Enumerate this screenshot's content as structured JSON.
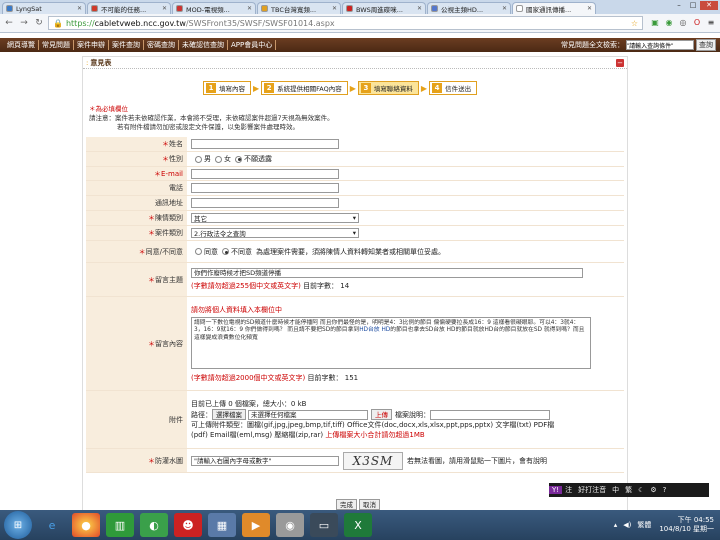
{
  "browser": {
    "tabs": [
      {
        "label": "LyngSat",
        "color": "#3a7ac8",
        "active": false
      },
      {
        "label": "不可能的任務...",
        "color": "#d03a2a",
        "active": false
      },
      {
        "label": "MOD-電視頻...",
        "color": "#cc3333",
        "active": false
      },
      {
        "label": "TBC台灣寬頻...",
        "color": "#e0a020",
        "active": false
      },
      {
        "label": "BWS周進碟咪...",
        "color": "#cc2222",
        "active": false
      },
      {
        "label": "公視主頻HD...",
        "color": "#5577cc",
        "active": false
      },
      {
        "label": "國家通訊傳播...",
        "color": "#ffffff",
        "active": true
      }
    ],
    "url_https": "https://",
    "url_domain": "cabletvweb.ncc.gov.tw",
    "url_path": "/SWSFront35/SWSF/SWSF01014.aspx"
  },
  "sitenav": {
    "links": [
      "網頁導覽",
      "常見問題",
      "案件申辦",
      "案件查詢",
      "密碼查詢",
      "未確認信查詢",
      "APP會員中心"
    ],
    "search_label": "常見問題全文檢索：",
    "search_placeholder": "\"請輸入查詢條件\"",
    "search_button": "查詢"
  },
  "panel": {
    "title": "意見表",
    "steps": [
      {
        "num": "1",
        "label": "填寫內容",
        "active": false
      },
      {
        "num": "2",
        "label": "系統提供相關FAQ內容",
        "active": false
      },
      {
        "num": "3",
        "label": "填寫聯絡資料",
        "active": true
      },
      {
        "num": "4",
        "label": "信件送出",
        "active": false
      }
    ],
    "notes": {
      "required": "＊為必填欄位",
      "line1": "請注意：案件若未依確認作業，本會將不受理，未依確認案件超過7天視為無效案件。",
      "line2": "若有附件檔請勿加密或設定文件保護，以免影響案件處理時效。"
    }
  },
  "form": {
    "name": {
      "label": "姓名",
      "value": ""
    },
    "gender": {
      "label": "性別",
      "options": [
        "男",
        "女",
        "不願透露"
      ],
      "selected": 2
    },
    "email": {
      "label": "E-mail",
      "value": ""
    },
    "phone": {
      "label": "電話",
      "value": ""
    },
    "address": {
      "label": "通訊地址",
      "value": ""
    },
    "category": {
      "label": "陳情類別",
      "value": "其它"
    },
    "case_type": {
      "label": "案件類別",
      "value": "2.行政法令之查詢"
    },
    "consent": {
      "label": "同意/不同意",
      "options": [
        "同意",
        "不同意"
      ],
      "selected": 1,
      "text": "為處理案件需要，須將陳情人資料轉知業者或相關單位妥處。"
    },
    "subject": {
      "label": "留言主題",
      "value": "你們作廢時候才把SD頻道停播",
      "hint": "(字數請勿超過255個中文或英文字)",
      "count_label": "目前字數：",
      "count": "14"
    },
    "content": {
      "label": "留言內容",
      "warning": "請勿將個人資料填入本欄位中",
      "text_pre": "請問一下數位電視的SD頻道什麼時候才能停播阿 而且你們最怪的是，明明是4：3比例的節目 偏偏硬要拉長成16：9 這樣看很礙眼耶。可以4：3就4：3，16：9就16：9 你們做得到嗎？ 而且請不要把SD的節目拿到",
      "text_hl1": "HD台放",
      "text_mid": " ",
      "text_hl2": "HD",
      "text_post": "的節目也拿去SD台放 HD的節目就放HD台的節目就放在SD 就得到嗎？而且這樣變成浪費數位化頻寬",
      "hint": "(字數請勿超過2000個中文或英文字)",
      "count_label": "目前字數：",
      "count": "151"
    },
    "attachment": {
      "label": "附件",
      "status": "目前已上傳 0 個檔案，總大小：0 kB",
      "path_label": "路徑：",
      "choose_button": "選擇檔案",
      "no_file": "未選擇任何檔案",
      "upload_button": "上傳",
      "desc_label": "檔案說明：",
      "types": "可上傳附件類型：圖檔(gif,jpg,jpeg,bmp,tif,tiff) Office文件(doc,docx,xls,xlsx,ppt,pps,pptx) 文字檔(txt) PDF檔",
      "types2": "(pdf) Email檔(eml,msg) 壓縮檔(zip,rar)",
      "limit": "上傳檔案大小合計請勿超過1MB"
    },
    "captcha": {
      "label": "防灌水圖",
      "placeholder": "\"請輸入右圖內字母或數字\"",
      "image_text": "X3SM",
      "help": "若無法看圖，請用滑鼠點一下圖片，會有說明"
    },
    "submit": "完成",
    "cancel": "取消"
  },
  "ime": {
    "items": [
      "注",
      "好打注音",
      "中",
      "繁"
    ]
  },
  "taskbar": {
    "lang": "繁體",
    "time": "下午 04:55",
    "date": "104/8/10 星期一"
  }
}
